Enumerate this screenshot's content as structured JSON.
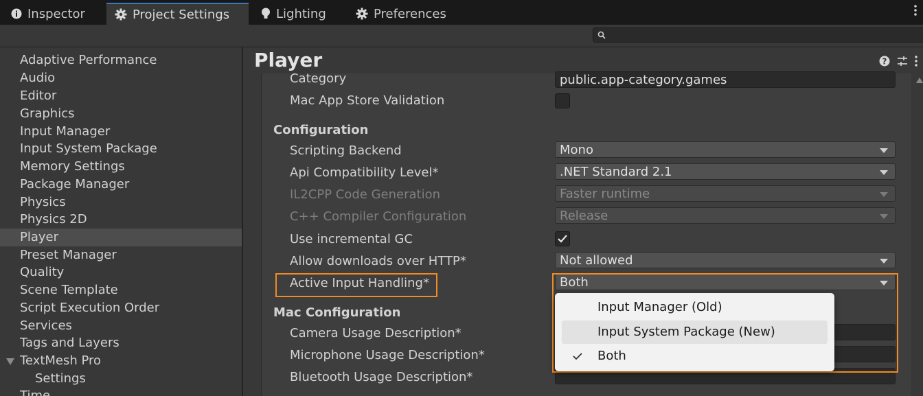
{
  "tabs": [
    {
      "label": "Inspector",
      "icon": "info-icon",
      "active": false
    },
    {
      "label": "Project Settings",
      "icon": "gear-icon",
      "active": true
    },
    {
      "label": "Lighting",
      "icon": "lightbulb-icon",
      "active": false
    },
    {
      "label": "Preferences",
      "icon": "gear-icon",
      "active": false
    }
  ],
  "search": {
    "value": "",
    "icon": "search-icon"
  },
  "sidebar": {
    "items": [
      {
        "label": "Adaptive Performance"
      },
      {
        "label": "Audio"
      },
      {
        "label": "Editor"
      },
      {
        "label": "Graphics"
      },
      {
        "label": "Input Manager"
      },
      {
        "label": "Input System Package"
      },
      {
        "label": "Memory Settings"
      },
      {
        "label": "Package Manager"
      },
      {
        "label": "Physics"
      },
      {
        "label": "Physics 2D"
      },
      {
        "label": "Player",
        "selected": true
      },
      {
        "label": "Preset Manager"
      },
      {
        "label": "Quality"
      },
      {
        "label": "Scene Template"
      },
      {
        "label": "Script Execution Order"
      },
      {
        "label": "Services"
      },
      {
        "label": "Tags and Layers"
      },
      {
        "label": "TextMesh Pro",
        "expanded": true
      },
      {
        "label": "Settings",
        "child": true
      },
      {
        "label": "Time"
      }
    ]
  },
  "main": {
    "title": "Player",
    "header_icons": [
      "help-icon",
      "preset-sliders-icon",
      "kebab-menu-icon"
    ],
    "fields": {
      "category": {
        "label": "Category",
        "value": "public.app-category.games"
      },
      "mac_app_store_validation": {
        "label": "Mac App Store Validation",
        "checked": false
      },
      "configuration_header": "Configuration",
      "scripting_backend": {
        "label": "Scripting Backend",
        "value": "Mono"
      },
      "api_compat": {
        "label": "Api Compatibility Level*",
        "value": ".NET Standard 2.1"
      },
      "il2cpp_codegen": {
        "label": "IL2CPP Code Generation",
        "value": "Faster runtime",
        "disabled": true
      },
      "cpp_compiler": {
        "label": "C++ Compiler Configuration",
        "value": "Release",
        "disabled": true
      },
      "incremental_gc": {
        "label": "Use incremental GC",
        "checked": true
      },
      "http_downloads": {
        "label": "Allow downloads over HTTP*",
        "value": "Not allowed"
      },
      "active_input": {
        "label": "Active Input Handling*",
        "value": "Both"
      },
      "mac_config_header": "Mac Configuration",
      "camera_usage": {
        "label": "Camera Usage Description*",
        "value": ""
      },
      "microphone_usage": {
        "label": "Microphone Usage Description*",
        "value": ""
      },
      "bluetooth_usage": {
        "label": "Bluetooth Usage Description*",
        "value": ""
      }
    }
  },
  "popup": {
    "options": [
      {
        "label": "Input Manager (Old)",
        "checked": false,
        "hover": false
      },
      {
        "label": "Input System Package (New)",
        "checked": false,
        "hover": true
      },
      {
        "label": "Both",
        "checked": true,
        "hover": false
      }
    ]
  },
  "highlight_color": "#f08a24",
  "accent_color": "#3a79bb"
}
